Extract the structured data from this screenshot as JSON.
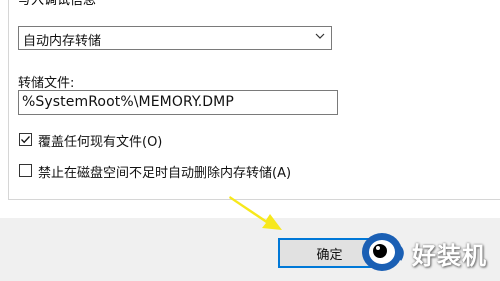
{
  "group": {
    "title": "写入调试信息"
  },
  "dump_type": {
    "selected": "自动内存转储"
  },
  "dump_file": {
    "label": "转储文件:",
    "value": "%SystemRoot%\\MEMORY.DMP"
  },
  "options": {
    "overwrite": {
      "label": "覆盖任何现有文件(O)",
      "checked": true
    },
    "disable_auto_delete": {
      "label": "禁止在磁盘空间不足时自动删除内存转储(A)",
      "checked": false
    }
  },
  "buttons": {
    "ok": "确定"
  },
  "watermark": {
    "text": "好装机"
  },
  "colors": {
    "accent": "#0078d7",
    "arrow": "#f7e81c"
  }
}
